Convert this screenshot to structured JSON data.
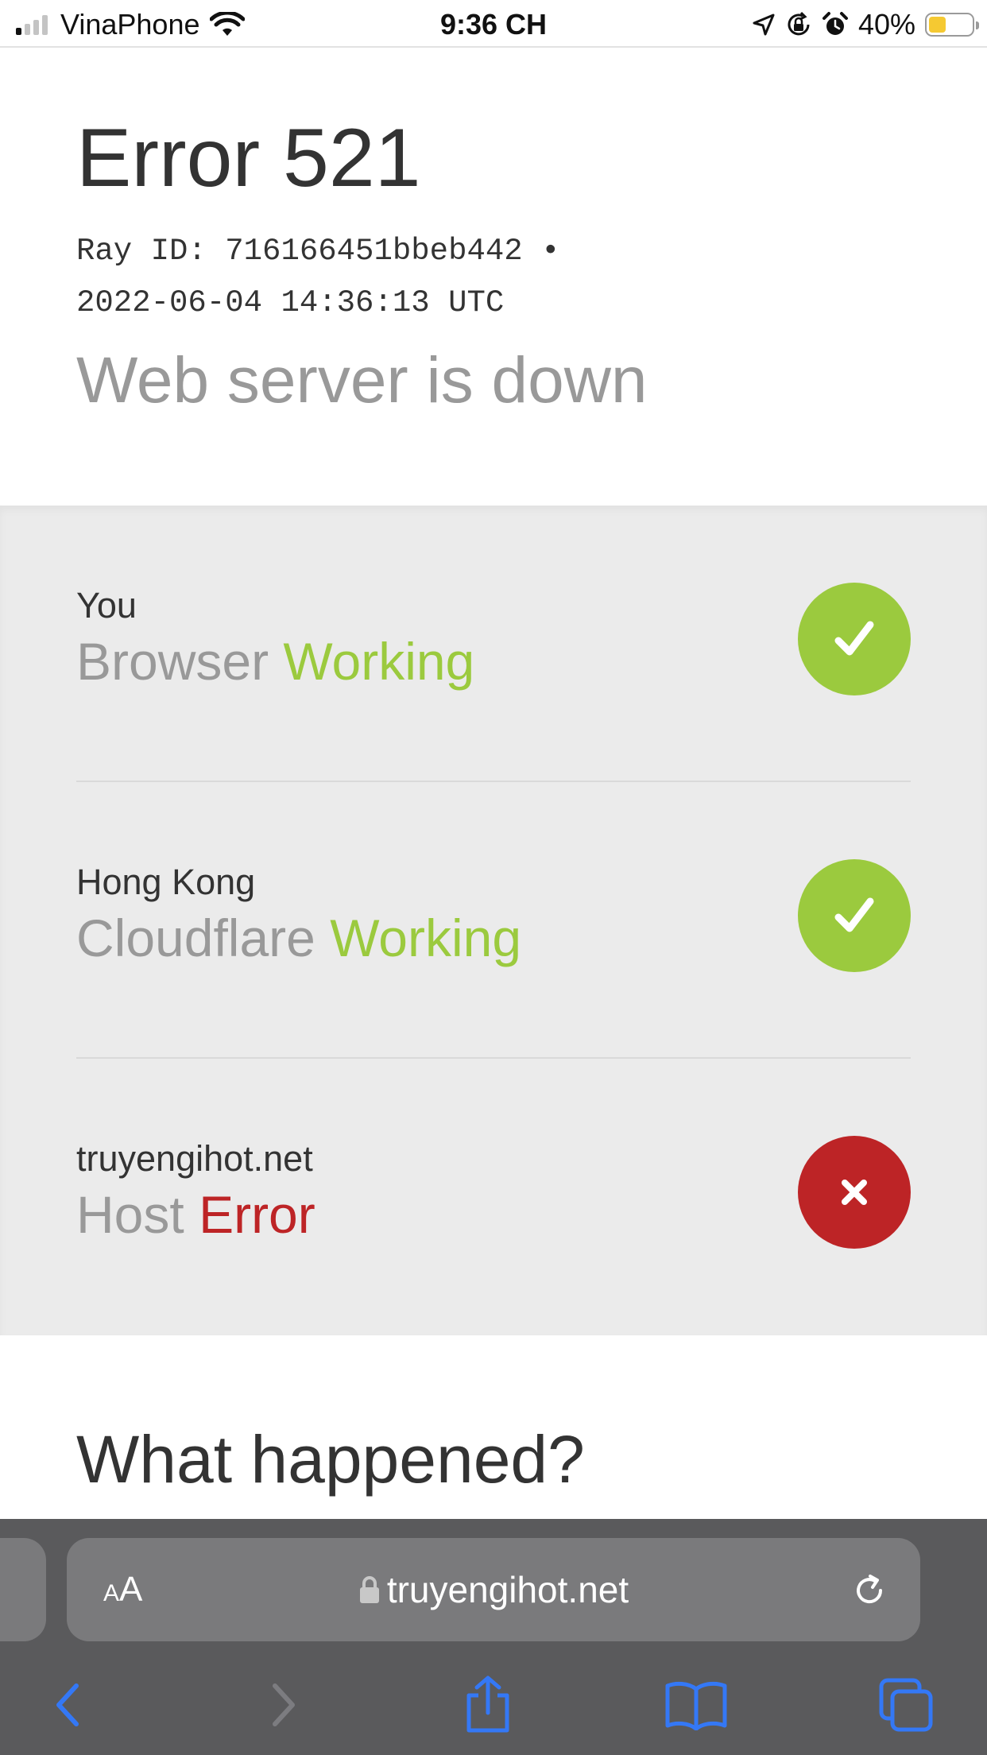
{
  "status_bar": {
    "carrier": "VinaPhone",
    "time": "9:36 CH",
    "battery_percent": "40%",
    "battery_level": 0.4,
    "signal_bars_active": 1,
    "icons": [
      "signal-icon",
      "wifi-icon",
      "location-icon",
      "orientation-lock-icon",
      "alarm-icon",
      "battery-icon"
    ]
  },
  "header": {
    "title": "Error 521",
    "ray_line_1": "Ray ID: 716166451bbeb442 •",
    "ray_line_2": "2022-06-04 14:36:13 UTC",
    "subtitle": "Web server is down"
  },
  "status_rows": [
    {
      "location": "You",
      "label": "Browser",
      "state": "Working",
      "ok": true
    },
    {
      "location": "Hong Kong",
      "label": "Cloudflare",
      "state": "Working",
      "ok": true
    },
    {
      "location": "truyengihot.net",
      "label": "Host",
      "state": "Error",
      "ok": false
    }
  ],
  "what_happened": {
    "title": "What happened?"
  },
  "browser": {
    "aa_small": "A",
    "aa_large": "A",
    "url": "truyengihot.net",
    "toolbar": [
      "back-icon",
      "forward-icon",
      "share-icon",
      "bookmarks-icon",
      "tabs-icon"
    ]
  },
  "colors": {
    "ok": "#9bca3e",
    "error": "#bd2426",
    "link_blue": "#3478f6",
    "battery": "#f5c932"
  }
}
